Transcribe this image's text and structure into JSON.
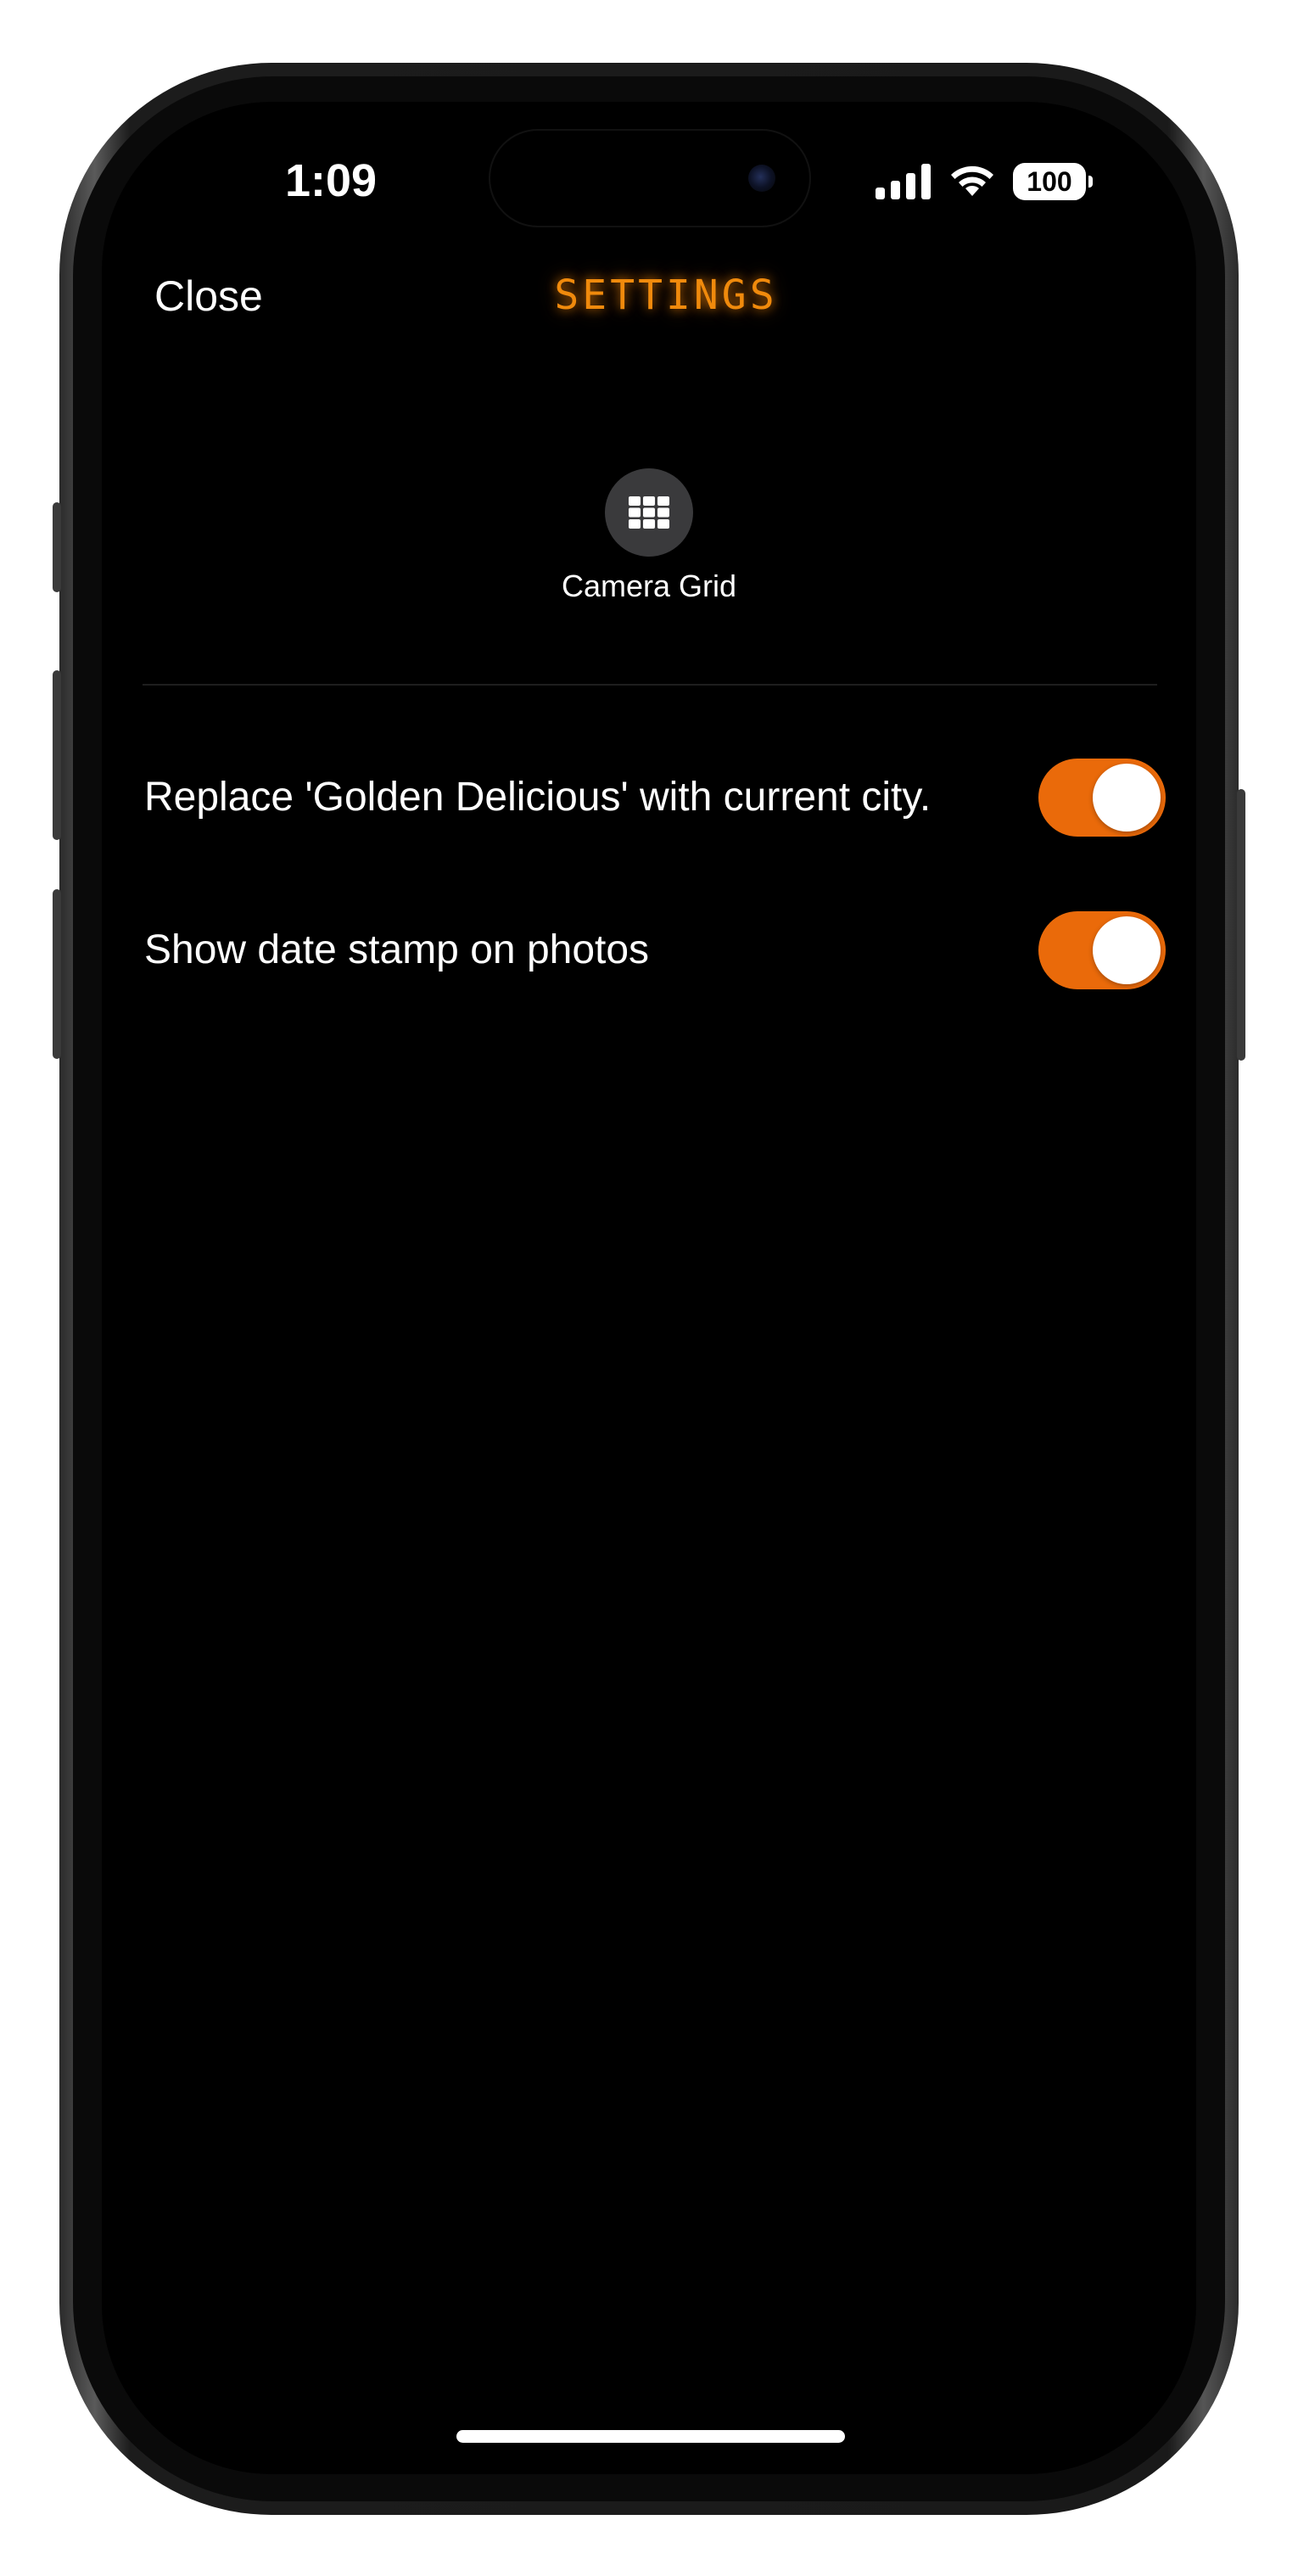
{
  "status_bar": {
    "time": "1:09",
    "battery": "100",
    "icons": [
      "cellular-signal-icon",
      "wifi-icon",
      "battery-icon"
    ]
  },
  "nav": {
    "close_label": "Close",
    "title": "SETTINGS"
  },
  "camera_grid": {
    "label": "Camera Grid",
    "icon": "grid-icon"
  },
  "settings": [
    {
      "label": "Replace 'Golden Delicious' with current city.",
      "enabled": true
    },
    {
      "label": "Show date stamp on photos",
      "enabled": true
    }
  ],
  "colors": {
    "accent": "#EA6A0A",
    "title_glow": "#F08A0C",
    "background": "#000000",
    "grid_button_bg": "#3A3A3C"
  }
}
